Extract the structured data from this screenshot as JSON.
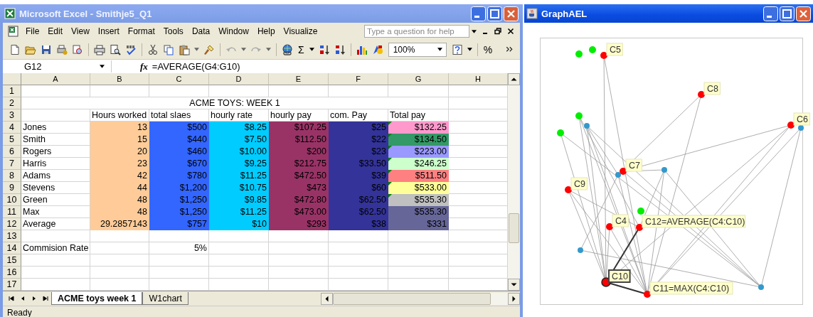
{
  "excel": {
    "title": "Microsoft Excel - Smithje5_Q1",
    "menu": [
      "File",
      "Edit",
      "View",
      "Insert",
      "Format",
      "Tools",
      "Data",
      "Window",
      "Help",
      "Visualize"
    ],
    "help_field": {
      "placeholder": "Type a question for help"
    },
    "toolbar": {
      "autosum": "Σ",
      "zoom": "100%",
      "percent": "%"
    },
    "name_box": "G12",
    "function_symbol": "fx",
    "formula": "=AVERAGE(G4:G10)",
    "columns": [
      {
        "label": "A"
      },
      {
        "label": "B",
        "color": "#ffcc99"
      },
      {
        "label": "C",
        "color": "#3366ff"
      },
      {
        "label": "D",
        "color": "#00ccff"
      },
      {
        "label": "E",
        "color": "#993366"
      },
      {
        "label": "F",
        "color": "#333399"
      },
      {
        "label": "G"
      },
      {
        "label": "H"
      }
    ],
    "rows": [
      {
        "number": "1",
        "kind": "blank"
      },
      {
        "number": "2",
        "kind": "title",
        "title": "ACME TOYS: WEEK 1"
      },
      {
        "number": "3",
        "kind": "header",
        "cells": [
          null,
          "Hours worked",
          "total slaes",
          "hourly rate",
          "hourly pay",
          "com. Pay",
          "Total pay"
        ]
      },
      {
        "number": "4",
        "kind": "data",
        "color": "#ff99cc",
        "note": true,
        "cells": [
          "Jones",
          "13",
          "$500",
          "$8.25",
          "$107.25",
          "$25",
          "$132.25"
        ]
      },
      {
        "number": "5",
        "kind": "data",
        "color": "#339966",
        "note": true,
        "cells": [
          "Smith",
          "15",
          "$440",
          "$7.50",
          "$112.50",
          "$22",
          "$134.50"
        ]
      },
      {
        "number": "6",
        "kind": "data",
        "color": "#9999ff",
        "note": true,
        "cells": [
          "Rogers",
          "20",
          "$460",
          "$10.00",
          "$200",
          "$23",
          "$223.00"
        ]
      },
      {
        "number": "7",
        "kind": "data",
        "color": "#ccffcc",
        "note": true,
        "cells": [
          "Harris",
          "23",
          "$670",
          "$9.25",
          "$212.75",
          "$33.50",
          "$246.25"
        ]
      },
      {
        "number": "8",
        "kind": "data",
        "color": "#ff8080",
        "note": true,
        "cells": [
          "Adams",
          "42",
          "$780",
          "$11.25",
          "$472.50",
          "$39",
          "$511.50"
        ]
      },
      {
        "number": "9",
        "kind": "data",
        "color": "#ffff99",
        "note": true,
        "cells": [
          "Stevens",
          "44",
          "$1,200",
          "$10.75",
          "$473",
          "$60",
          "$533.00"
        ]
      },
      {
        "number": "10",
        "kind": "data",
        "color": "#c0c0c0",
        "note": true,
        "cells": [
          "Green",
          "48",
          "$1,250",
          "$9.85",
          "$472.80",
          "$62.50",
          "$535.30"
        ]
      },
      {
        "number": "11",
        "kind": "data",
        "color": "#666699",
        "note": false,
        "cells": [
          "Max",
          "48",
          "$1,250",
          "$11.25",
          "$473.00",
          "$62.50",
          "$535.30"
        ]
      },
      {
        "number": "12",
        "kind": "data",
        "color": "#666699",
        "note": false,
        "cells": [
          "Average",
          "29.2857143",
          "$757",
          "$10",
          "$293",
          "$38",
          "$331"
        ]
      },
      {
        "number": "13",
        "kind": "blank"
      },
      {
        "number": "14",
        "kind": "plain",
        "cells": [
          "Commision Rate",
          null,
          "5%"
        ]
      },
      {
        "number": "15",
        "kind": "blank"
      },
      {
        "number": "16",
        "kind": "blank"
      },
      {
        "number": "17",
        "kind": "blank"
      }
    ],
    "sheet_tabs": [
      {
        "label": "ACME toys week 1",
        "selected": true
      },
      {
        "label": "W1chart",
        "selected": false
      }
    ],
    "status": "Ready"
  },
  "graph": {
    "title": "GraphAEL",
    "nodes": [
      {
        "color": "#00ee00",
        "selected": false
      },
      {
        "color": "#00ee00",
        "selected": false
      },
      {
        "label": "C5",
        "color": "#ff0000",
        "selected": false
      },
      {
        "label": "C8",
        "color": "#ff0000",
        "selected": false
      },
      {
        "color": "#00ee00",
        "selected": false
      },
      {
        "color": "#3399cc",
        "selected": false
      },
      {
        "color": "#00ee00",
        "selected": false
      },
      {
        "label": "C6",
        "color": "#ff0000",
        "selected": false
      },
      {
        "color": "#3399cc",
        "selected": false
      },
      {
        "label": "C7",
        "color": "#ff0000",
        "selected": false
      },
      {
        "color": "#3399cc",
        "selected": false
      },
      {
        "color": "#3399cc",
        "selected": false
      },
      {
        "label": "C9",
        "color": "#ff0000",
        "selected": false
      },
      {
        "color": "#00ee00",
        "selected": false
      },
      {
        "label": "C4",
        "color": "#ff0000",
        "selected": false
      },
      {
        "label": "C12=AVERAGE(C4:C10)",
        "color": "#ff0000",
        "selected": false
      },
      {
        "color": "#3399cc",
        "selected": false
      },
      {
        "label": "C10",
        "color": "#ff0000",
        "selected": true
      },
      {
        "label": "C11=MAX(C4:C10)",
        "color": "#ff0000",
        "selected": false
      },
      {
        "color": "#3399cc",
        "selected": false
      }
    ]
  }
}
